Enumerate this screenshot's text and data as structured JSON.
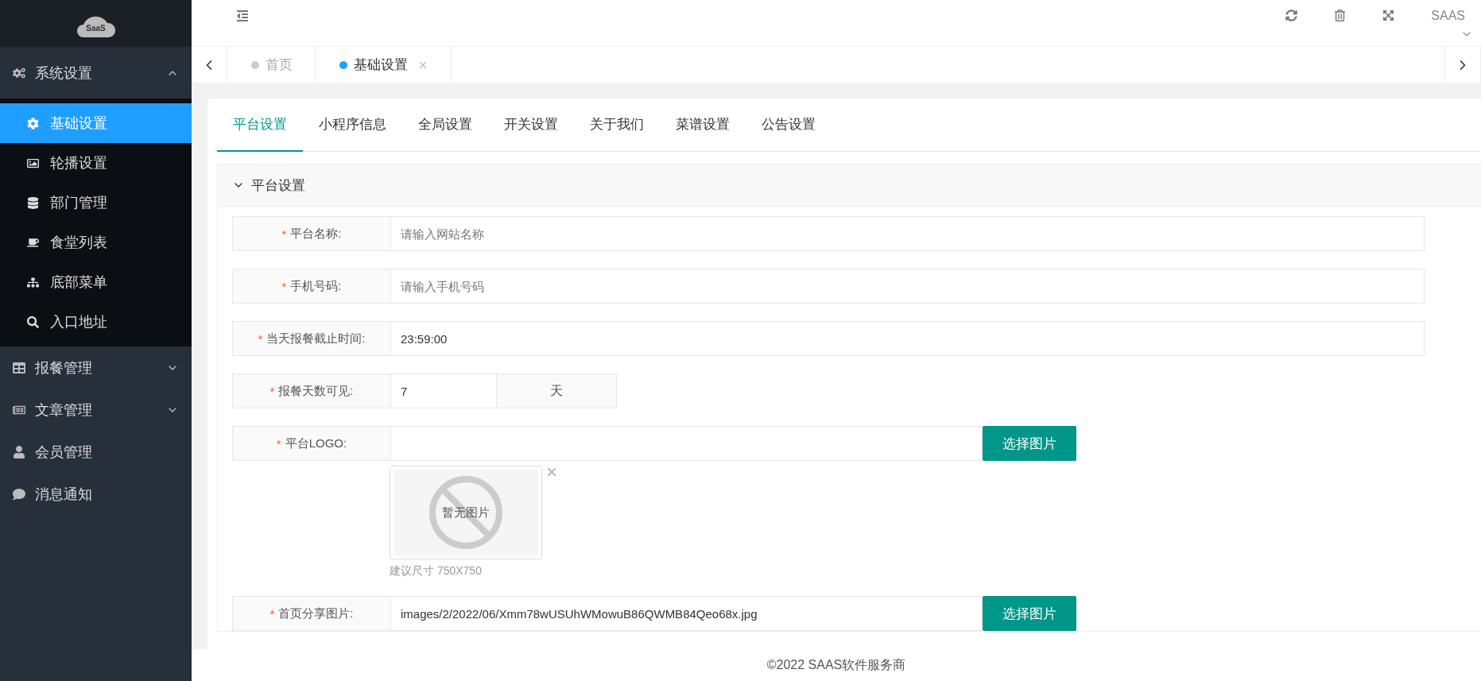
{
  "logo": {
    "text": "SaaS"
  },
  "sidebar": {
    "items": [
      {
        "label": "系统设置",
        "kind": "group",
        "expanded": true,
        "children": [
          {
            "label": "基础设置",
            "selected": true
          },
          {
            "label": "轮播设置",
            "selected": false
          },
          {
            "label": "部门管理",
            "selected": false
          },
          {
            "label": "食堂列表",
            "selected": false
          },
          {
            "label": "底部菜单",
            "selected": false
          },
          {
            "label": "入口地址",
            "selected": false
          }
        ]
      },
      {
        "label": "报餐管理",
        "kind": "group",
        "expanded": false
      },
      {
        "label": "文章管理",
        "kind": "group",
        "expanded": false
      },
      {
        "label": "会员管理",
        "kind": "link"
      },
      {
        "label": "消息通知",
        "kind": "link"
      }
    ]
  },
  "header": {
    "user": "SAAS"
  },
  "page_tabs": [
    {
      "label": "首页",
      "selected": false,
      "closable": false
    },
    {
      "label": "基础设置",
      "selected": true,
      "closable": true
    }
  ],
  "settings_tabs": [
    {
      "label": "平台设置",
      "selected": true
    },
    {
      "label": "小程序信息",
      "selected": false
    },
    {
      "label": "全局设置",
      "selected": false
    },
    {
      "label": "开关设置",
      "selected": false
    },
    {
      "label": "关于我们",
      "selected": false
    },
    {
      "label": "菜谱设置",
      "selected": false
    },
    {
      "label": "公告设置",
      "selected": false
    }
  ],
  "panel": {
    "title": "平台设置",
    "expanded": true
  },
  "fields": [
    {
      "kind": "text",
      "label": "平台名称:",
      "required_mark": "*",
      "placeholder": "请输入网站名称"
    },
    {
      "kind": "text",
      "label": "手机号码:",
      "required_mark": "*",
      "placeholder": "请输入手机号码"
    },
    {
      "kind": "text",
      "label": "当天报餐截止时间:",
      "required_mark": "*",
      "value": "23:59:00"
    },
    {
      "kind": "addon",
      "label": "报餐天数可见:",
      "required_mark": "*",
      "value": "7",
      "addon": "天"
    },
    {
      "kind": "image",
      "label": "平台LOGO:",
      "required_mark": "*",
      "button": "选择图片",
      "preview": "暂无图片",
      "hint": "建议尺寸 750X750"
    },
    {
      "kind": "image",
      "label": "首页分享图片:",
      "required_mark": "*",
      "value": "images/2/2022/06/Xmm78wUSUhWMowuB86QWMB84Qeo68x.jpg",
      "button": "选择图片"
    }
  ],
  "footer": {
    "text": "©2022 SAAS软件服务商"
  }
}
